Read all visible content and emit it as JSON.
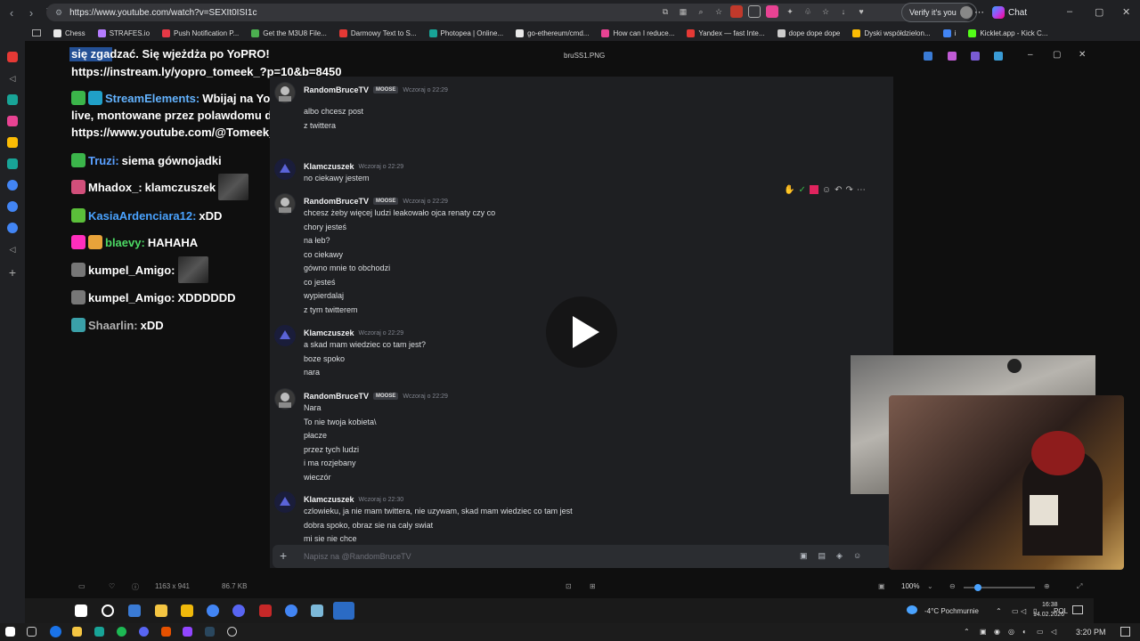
{
  "browser": {
    "url": "https://www.youtube.com/watch?v=SEXIt0ISI1c",
    "verify_label": "Verify it's you",
    "chat_label": "Chat",
    "bookmarks": [
      {
        "label": "Chess",
        "color": "#e8e8e8"
      },
      {
        "label": "STRAFES.io",
        "color": "#b57cff"
      },
      {
        "label": "Push Notification P...",
        "color": "#e63946"
      },
      {
        "label": "Get the M3U8 File...",
        "color": "#4caf50"
      },
      {
        "label": "Darmowy Text to S...",
        "color": "#e53935"
      },
      {
        "label": "Photopea | Online...",
        "color": "#18a497"
      },
      {
        "label": "go-ethereum/cmd...",
        "color": "#e8e8e8"
      },
      {
        "label": "How can I reduce...",
        "color": "#e84393"
      },
      {
        "label": "Yandex — fast Inte...",
        "color": "#e53935"
      },
      {
        "label": "dope dope dope",
        "color": "#cccccc"
      },
      {
        "label": "Dyski współdzielon...",
        "color": "#fbbc04"
      },
      {
        "label": "i",
        "color": "#4285f4"
      },
      {
        "label": "Kicklet.app - Kick C...",
        "color": "#53fc18"
      }
    ]
  },
  "stream_chat": {
    "header_line1": "się zgadzać. Się wjeżdża po YoPRO!",
    "header_line2": "https://instream.ly/yopro_tomeek_?p=10&b=8450",
    "lines": [
      {
        "user": "StreamElements:",
        "user_color": "#63b3ff",
        "text": "Wbijaj na Youtube! Potężne skróty",
        "text2": "live, montowane przez polawdomu dostępne na:",
        "text3": "https://www.youtube.com/@Tomeek_ Zostaw subaaaa!"
      },
      {
        "user": "Truzi:",
        "user_color": "#5aa0ff",
        "text": "siema gównojadki"
      },
      {
        "user": "Mhadox_:",
        "user_color": "#ffffff",
        "text": "klamczuszek"
      },
      {
        "user": "KasiaArdenciara12:",
        "user_color": "#4aa3ff",
        "text": "xDD"
      },
      {
        "user": "blaevy:",
        "user_color": "#4cd964",
        "text": "HAHAHA"
      },
      {
        "user": "kumpel_Amigo:",
        "user_color": "#ffffff",
        "text": ""
      },
      {
        "user": "kumpel_Amigo:",
        "user_color": "#ffffff",
        "text": "XDDDDDD"
      },
      {
        "user": "Shaarlin:",
        "user_color": "#b0b0b0",
        "text": "xDD"
      }
    ]
  },
  "viewer": {
    "filename": "bruSS1.PNG",
    "dimensions": "1163 x 941",
    "filesize": "86.7 KB",
    "zoom": "100%"
  },
  "discord": {
    "messages": [
      {
        "author": "RandomBruceTV",
        "tag": "MOOSE",
        "time": "Wczoraj o 22:29",
        "lines": [
          "albo chcesz post",
          "z twittera"
        ]
      },
      {
        "author": "Klamczuszek",
        "tag": "",
        "time": "Wczoraj o 22:29",
        "lines": [
          "no ciekawy jestem"
        ]
      },
      {
        "author": "RandomBruceTV",
        "tag": "MOOSE",
        "time": "Wczoraj o 22:29",
        "lines": [
          "chcesz żeby więcej ludzi leakowało ojca renaty czy co",
          "chory jesteś",
          "na łeb?",
          "co ciekawy",
          "gówno mnie to obchodzi",
          "co jesteś",
          "wypierdalaj",
          "z tym twitterem"
        ]
      },
      {
        "author": "Klamczuszek",
        "tag": "",
        "time": "Wczoraj o 22:29",
        "lines": [
          "a skad mam wiedziec co tam jest?",
          "boze spoko",
          "nara"
        ]
      },
      {
        "author": "RandomBruceTV",
        "tag": "MOOSE",
        "time": "Wczoraj o 22:29",
        "lines": [
          "Nara",
          "To nie twoja kobieta\\",
          "płacze",
          "przez tych ludzi",
          "i ma rozjebany",
          "wieczór"
        ]
      },
      {
        "author": "Klamczuszek",
        "tag": "",
        "time": "Wczoraj o 22:30",
        "lines": [
          "czlowieku, ja nie mam twittera, nie uzywam, skad mam wiedziec co tam jest",
          "dobra spoko, obraz sie na caly swiat",
          "mi sie nie chce"
        ]
      }
    ],
    "compose_placeholder": "Napisz na @RandomBruceTV"
  },
  "taskbar": {
    "weather": "-4°C Pochmurnie",
    "lang": "POL",
    "time_inner": "16:38",
    "date_inner": "14.02.2026",
    "time_outer": "3:20 PM"
  }
}
